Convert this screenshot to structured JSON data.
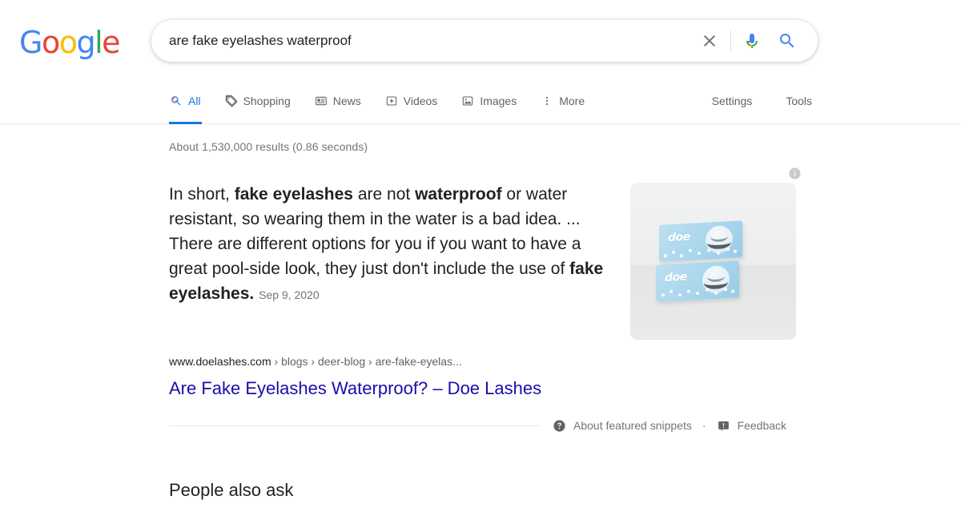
{
  "brand": {
    "name": "Google",
    "letters": [
      {
        "char": "G",
        "color": "#4285F4"
      },
      {
        "char": "o",
        "color": "#EA4335"
      },
      {
        "char": "o",
        "color": "#FBBC05"
      },
      {
        "char": "g",
        "color": "#4285F4"
      },
      {
        "char": "l",
        "color": "#34A853"
      },
      {
        "char": "e",
        "color": "#EA4335"
      }
    ]
  },
  "search": {
    "query": "are fake eyelashes waterproof",
    "placeholder": "Search",
    "clear_icon": "close-icon",
    "voice_icon": "microphone-icon",
    "search_icon": "search-icon"
  },
  "nav": {
    "tabs": [
      {
        "label": "All",
        "icon": "search-icon",
        "active": true
      },
      {
        "label": "Shopping",
        "icon": "tag-icon",
        "active": false
      },
      {
        "label": "News",
        "icon": "news-icon",
        "active": false
      },
      {
        "label": "Videos",
        "icon": "video-icon",
        "active": false
      },
      {
        "label": "Images",
        "icon": "image-icon",
        "active": false
      },
      {
        "label": "More",
        "icon": "more-vertical-icon",
        "active": false
      }
    ],
    "settings_label": "Settings",
    "tools_label": "Tools"
  },
  "results": {
    "stats": "About 1,530,000 results (0.86 seconds)",
    "featured_snippet": {
      "text_parts": [
        {
          "text": "In short, ",
          "bold": false
        },
        {
          "text": "fake eyelashes",
          "bold": true
        },
        {
          "text": " are not ",
          "bold": false
        },
        {
          "text": "waterproof",
          "bold": true
        },
        {
          "text": " or water resistant, so wearing them in the water is a bad idea. ... There are different options for you if you want to have a great pool-side look, they just don't include the use of ",
          "bold": false
        },
        {
          "text": "fake eyelashes",
          "bold": true
        },
        {
          "text": ".",
          "bold": false
        }
      ],
      "date": "Sep 9, 2020",
      "thumbnail": {
        "alt": "doe lashes product boxes",
        "brand_text": "doe",
        "info_icon": "info-icon",
        "background_color": "#e9eaec",
        "box_color": "#a9d6ee"
      },
      "breadcrumb": {
        "domain": "www.doelashes.com",
        "path": " › blogs › deer-blog › are-fake-eyelas..."
      },
      "title": "Are Fake Eyelashes Waterproof? – Doe Lashes",
      "about_label": "About featured snippets",
      "about_icon": "help-circle-icon",
      "separator": "·",
      "feedback_label": "Feedback",
      "feedback_icon": "feedback-flag-icon"
    },
    "people_also_ask_title": "People also ask"
  },
  "colors": {
    "link": "#1a0dab",
    "accent": "#1a73e8",
    "text": "#202124",
    "muted": "#70757a"
  }
}
